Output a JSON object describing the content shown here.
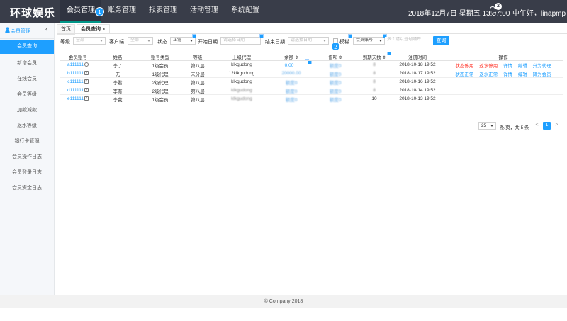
{
  "app": {
    "brand": "环球娱乐"
  },
  "topnav": [
    {
      "label": "会员管理",
      "active": true
    },
    {
      "label": "账务管理",
      "active": false
    },
    {
      "label": "报表管理",
      "active": false
    },
    {
      "label": "活动管理",
      "active": false
    },
    {
      "label": "系统配置",
      "active": false
    }
  ],
  "header": {
    "datetime": "2018年12月7日 星期五 13:57:00",
    "notify_count": "2",
    "greeting": "中午好，linapmp"
  },
  "markers": {
    "m1": "1",
    "m2": "2"
  },
  "sidebar": {
    "title": "会员管理",
    "collapse_glyph": "‹",
    "items": [
      "会员查询",
      "新增会员",
      "在线会员",
      "会员等级",
      "加款减款",
      "返水等级",
      "银行卡管理",
      "会员操作日志",
      "会员登录日志",
      "会员资金日志"
    ]
  },
  "tabs": [
    {
      "label": "首页",
      "close": ""
    },
    {
      "label": "会员查询",
      "close": "x"
    }
  ],
  "filters": {
    "level_label": "等级",
    "level_value": "全部",
    "client_label": "客户端",
    "client_value": "全部",
    "status_label": "状态",
    "status_value": "正常",
    "start_label": "开始日期",
    "start_placeholder": "请选择日期",
    "end_label": "结束日期",
    "end_placeholder": "请选择日期",
    "fuzzy_label": "模糊",
    "field_value": "会员账号",
    "keyword_placeholder": "多个请以逗号隔开",
    "search_label": "查询"
  },
  "table": {
    "headers": [
      "会员账号",
      "姓名",
      "账号类型",
      "等级",
      "上级代理",
      "余额",
      "借呗",
      "到期天数",
      "注册时间",
      "操作"
    ],
    "sort_glyph": "⇕",
    "rows": [
      {
        "account": "a111111",
        "name": "李了",
        "type": "1级会员",
        "level": "第八层",
        "agent": "klkgudong",
        "balance": "0.00",
        "borrow": "额度0",
        "days": "8",
        "reg": "2018-10-18 19:52",
        "ops": [
          {
            "label": "状态停用",
            "red": true
          },
          {
            "label": "返水停用",
            "red": true
          },
          {
            "label": "详情",
            "red": false
          },
          {
            "label": "编辑",
            "red": false
          },
          {
            "label": "升为代理",
            "red": false
          }
        ]
      },
      {
        "account": "b111111",
        "name": "无",
        "type": "1级代理",
        "level": "未分层",
        "agent": "12klkgudong",
        "balance": "20000.00",
        "borrow": "额度0",
        "days": "8",
        "reg": "2018-10-17 19:52",
        "ops": [
          {
            "label": "状态正常",
            "red": false
          },
          {
            "label": "返水正常",
            "red": false
          },
          {
            "label": "详情",
            "red": false
          },
          {
            "label": "编辑",
            "red": false
          },
          {
            "label": "降为会员",
            "red": false
          }
        ]
      },
      {
        "account": "c111111",
        "name": "李看",
        "type": "2级代理",
        "level": "第八层",
        "agent": "klkgudong",
        "balance": "额度0",
        "borrow": "额度0",
        "days": "8",
        "reg": "2018-10-16 19:52",
        "ops": []
      },
      {
        "account": "d111111",
        "name": "李有",
        "type": "2级代理",
        "level": "第八层",
        "agent": "klkgudong",
        "balance": "额度0",
        "borrow": "额度0",
        "days": "8",
        "reg": "2018-10-14 19:52",
        "ops": []
      },
      {
        "account": "e111111",
        "name": "李我",
        "type": "1级会员",
        "level": "第八层",
        "agent": "klkgudong",
        "balance": "额度0",
        "borrow": "额度0",
        "days": "10",
        "reg": "2018-10-13 19:52",
        "ops": []
      }
    ]
  },
  "pagination": {
    "page_size": "25",
    "summary": "条/页，共 5 条",
    "prev": "<",
    "current": "1",
    "next": ">"
  },
  "footer": {
    "text": "© Company 2018"
  },
  "colors": {
    "topbar": "#393d49",
    "accent": "#1e9fff",
    "danger": "#ff3b30"
  }
}
